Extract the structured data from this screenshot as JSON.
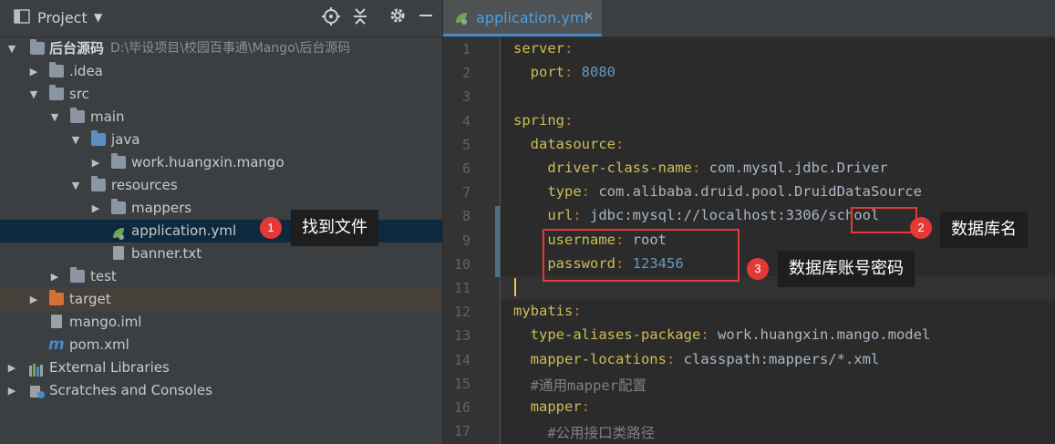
{
  "project_panel": {
    "title": "Project",
    "tree": [
      {
        "label": "后台源码",
        "path": "D:\\毕设项目\\校园百事通\\Mango\\后台源码"
      },
      {
        "label": ".idea"
      },
      {
        "label": "src"
      },
      {
        "label": "main"
      },
      {
        "label": "java"
      },
      {
        "label": "work.huangxin.mango"
      },
      {
        "label": "resources"
      },
      {
        "label": "mappers"
      },
      {
        "label": "application.yml"
      },
      {
        "label": "banner.txt"
      },
      {
        "label": "test"
      },
      {
        "label": "target"
      },
      {
        "label": "mango.iml"
      },
      {
        "label": "pom.xml"
      },
      {
        "label": "External Libraries"
      },
      {
        "label": "Scratches and Consoles"
      }
    ]
  },
  "editor": {
    "tab_label": "application.yml",
    "tab_close": "×",
    "lines": [
      {
        "n": "1",
        "key": "server",
        "sep": ":",
        "val": ""
      },
      {
        "n": "2",
        "key": "  port",
        "sep": ": ",
        "val": "8080"
      },
      {
        "n": "3",
        "key": "",
        "sep": "",
        "val": ""
      },
      {
        "n": "4",
        "key": "spring",
        "sep": ":",
        "val": ""
      },
      {
        "n": "5",
        "key": "  datasource",
        "sep": ":",
        "val": ""
      },
      {
        "n": "6",
        "key": "    driver-class-name",
        "sep": ": ",
        "val": "com.mysql.jdbc.Driver"
      },
      {
        "n": "7",
        "key": "    type",
        "sep": ": ",
        "val": "com.alibaba.druid.pool.DruidDataSource"
      },
      {
        "n": "8",
        "key": "    url",
        "sep": ": ",
        "val": "jdbc:mysql://localhost:3306/school"
      },
      {
        "n": "9",
        "key": "    username",
        "sep": ": ",
        "val": "root"
      },
      {
        "n": "10",
        "key": "    password",
        "sep": ": ",
        "val": "123456"
      },
      {
        "n": "11",
        "key": "",
        "sep": "",
        "val": ""
      },
      {
        "n": "12",
        "key": "mybatis",
        "sep": ":",
        "val": ""
      },
      {
        "n": "13",
        "key": "  type-aliases-package",
        "sep": ": ",
        "val": "work.huangxin.mango.model"
      },
      {
        "n": "14",
        "key": "  mapper-locations",
        "sep": ": ",
        "val": "classpath:mappers/*.xml"
      },
      {
        "n": "15",
        "key": "  #通用mapper配置",
        "sep": "",
        "val": ""
      },
      {
        "n": "16",
        "key": "  mapper",
        "sep": ":",
        "val": ""
      },
      {
        "n": "17",
        "key": "    #公用接口类路径",
        "sep": "",
        "val": ""
      }
    ]
  },
  "annotations": [
    {
      "num": "1",
      "text": "找到文件"
    },
    {
      "num": "2",
      "text": "数据库名"
    },
    {
      "num": "3",
      "text": "数据库账号密码"
    }
  ]
}
